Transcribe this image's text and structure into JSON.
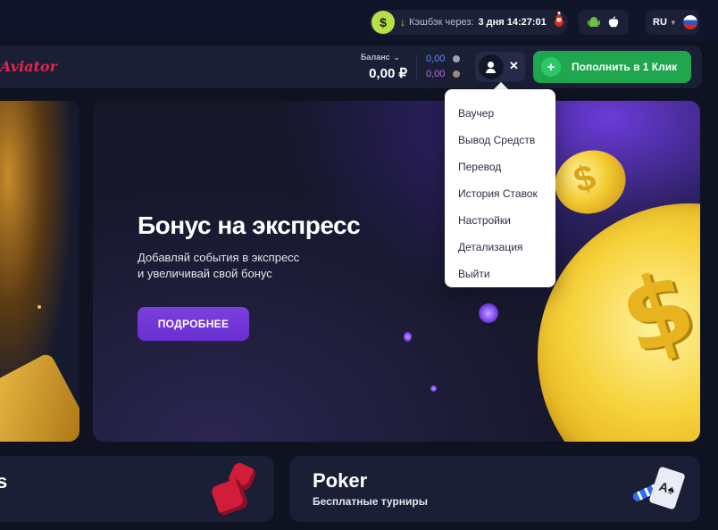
{
  "topbar": {
    "cashback_label": "Кэшбэк через:",
    "cashback_time": "3 дня 14:27:01",
    "language": "RU"
  },
  "header": {
    "logo": "Aviator",
    "balance_label": "Баланс",
    "balance_value": "0,00 ₽",
    "sub_balance_1": "0,00",
    "sub_balance_2": "0,00",
    "deposit_label": "Пополнить в 1 Клик"
  },
  "dropdown": {
    "items": [
      "Ваучер",
      "Вывод Средств",
      "Перевод",
      "История Ставок",
      "Настройки",
      "Детализация",
      "Выйти"
    ]
  },
  "banner": {
    "title": "Бонус на экспресс",
    "subtitle_line1": "Добавляй события в экспресс",
    "subtitle_line2": "и увеличивай свой бонус",
    "button": "ПОДРОБНЕЕ"
  },
  "cards": {
    "left_title": "s",
    "right_title": "Poker",
    "right_subtitle": "Бесплатные турниры"
  },
  "colors": {
    "background": "#0f1221",
    "header": "#1a1f35",
    "deposit_green": "#1fa64f",
    "accent_purple": "#7c3fe0",
    "logo_red": "#e3254a"
  }
}
